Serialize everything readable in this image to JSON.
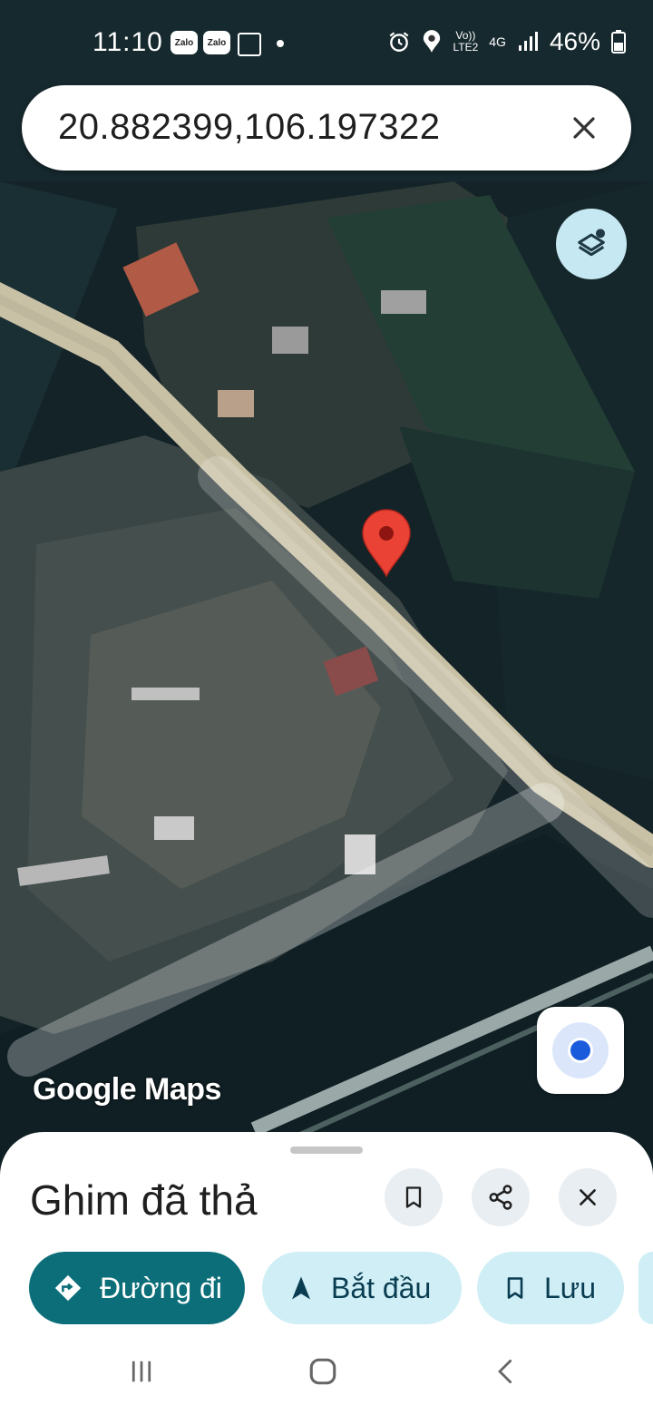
{
  "status_bar": {
    "time": "11:10",
    "notifications": [
      "Zalo",
      "Zalo"
    ],
    "network_label_top": "Vo))",
    "network_label_bottom": "LTE2",
    "network_type": "4G",
    "battery": "46%"
  },
  "search": {
    "value": "20.882399,106.197322"
  },
  "map": {
    "watermark": "Google Maps",
    "pin_color": "#ea4335"
  },
  "sheet": {
    "title": "Ghim đã thả",
    "actions": {
      "directions": "Đường đi",
      "start": "Bắt đầu",
      "save": "Lưu"
    }
  },
  "colors": {
    "primary": "#0b6e78",
    "chip": "#cfeef5",
    "layers": "#c6e8f3",
    "location": "#1a5bdc"
  }
}
